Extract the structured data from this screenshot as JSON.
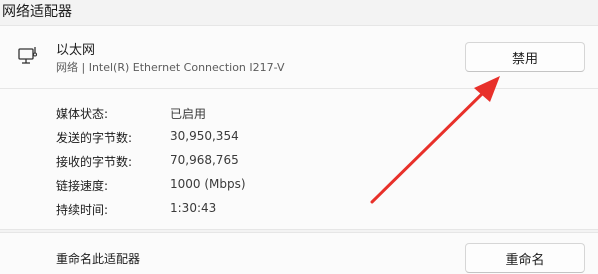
{
  "section_title": "网络适配器",
  "adapter": {
    "name": "以太网",
    "description": "网络 | Intel(R) Ethernet Connection I217-V",
    "disable_button": "禁用",
    "icon": "monitor-network-icon"
  },
  "properties": [
    {
      "label": "媒体状态:",
      "value": "已启用"
    },
    {
      "label": "发送的字节数:",
      "value": "30,950,354"
    },
    {
      "label": "接收的字节数:",
      "value": "70,968,765"
    },
    {
      "label": "链接速度:",
      "value": "1000 (Mbps)"
    },
    {
      "label": "持续时间:",
      "value": "1:30:43"
    }
  ],
  "rename": {
    "label": "重命名此适配器",
    "button": "重命名"
  },
  "annotation": {
    "arrow_color": "#e8302a"
  }
}
